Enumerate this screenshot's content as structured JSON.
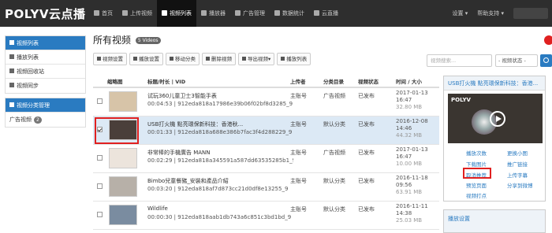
{
  "brand": {
    "logo": "POLYV云点播"
  },
  "nav": [
    {
      "label": "首页",
      "icon": "home-icon"
    },
    {
      "label": "上传视频",
      "icon": "upload-icon"
    },
    {
      "label": "视频列表",
      "icon": "list-icon"
    },
    {
      "label": "播放器",
      "icon": "player-icon"
    },
    {
      "label": "广告管理",
      "icon": "ad-icon"
    },
    {
      "label": "数据统计",
      "icon": "chart-icon"
    },
    {
      "label": "云直播",
      "icon": "live-icon"
    }
  ],
  "topRight": {
    "settings": "设置 ▾",
    "support": "帮助支持 ▾"
  },
  "sidebar": {
    "group1": [
      "视频列表",
      "播放列表",
      "视频回收站",
      "视频同步"
    ],
    "group2": {
      "title": "视频分类管理",
      "item": "广告视频",
      "count": "2"
    }
  },
  "main": {
    "title": "所有视频",
    "count": "5 Videos"
  },
  "toolbar": [
    "视频设置",
    "播放设置",
    "移动分类",
    "删除视频",
    "导出视频▾",
    "播放列表"
  ],
  "search": {
    "placeholder": "视频搜索...",
    "status": "- 视频状态 -"
  },
  "table": {
    "headers": [
      "缩略图",
      "标题/时长 | VID",
      "上传者",
      "分类目录",
      "视频状态",
      "时间 / 大小"
    ],
    "rows": [
      {
        "title": "试玩360儿童卫士3智能手表",
        "meta": "00:04:53 | 912eda818a17986e39b06f02bf8d3285_9",
        "uploader": "主账号",
        "category": "广告视频",
        "status": "已发布",
        "date": "2017-01-13",
        "time": "16:47",
        "size": "32.80 MB",
        "checked": false
      },
      {
        "title": "USB打火機 點亮環保新科技：香港秋...",
        "meta": "00:01:33 | 912eda818a688e386b7fac3f4d288229_9",
        "uploader": "主账号",
        "category": "默认分类",
        "status": "已发布",
        "date": "2016-12-08",
        "time": "14:46",
        "size": "44.32 MB",
        "checked": true
      },
      {
        "title": "非常棒的手機廣告 MANN",
        "meta": "00:02:29 | 912eda818a345591a587dd63535285b1_9",
        "uploader": "主账号",
        "category": "广告视频",
        "status": "已发布",
        "date": "2017-01-13",
        "time": "16:47",
        "size": "10.00 MB",
        "checked": false
      },
      {
        "title": "Bimbo兒童餐豬_安裝和產品介紹",
        "meta": "00:03:20 | 912eda818af7d873cc21d0df8e13255_9",
        "uploader": "主账号",
        "category": "默认分类",
        "status": "已发布",
        "date": "2016-11-18",
        "time": "09:56",
        "size": "63.91 MB",
        "checked": false
      },
      {
        "title": "Wildlife",
        "meta": "00:00:30 | 912eda818aab1db743a6c851c3bd1bd_9",
        "uploader": "主账号",
        "category": "默认分类",
        "status": "已发布",
        "date": "2016-11-11",
        "time": "14:38",
        "size": "25.03 MB",
        "checked": false
      }
    ]
  },
  "panel": {
    "title": "USB打火機 點亮環保新科技：香港...",
    "previewLogo": "POLYV",
    "links": [
      "播放次数",
      "更换小图",
      "下载图片",
      "推广链接",
      "取消推荐",
      "上传字幕",
      "预览页面",
      "分享到微博",
      "视频打点"
    ]
  },
  "panel2": {
    "title": "播放设置"
  }
}
